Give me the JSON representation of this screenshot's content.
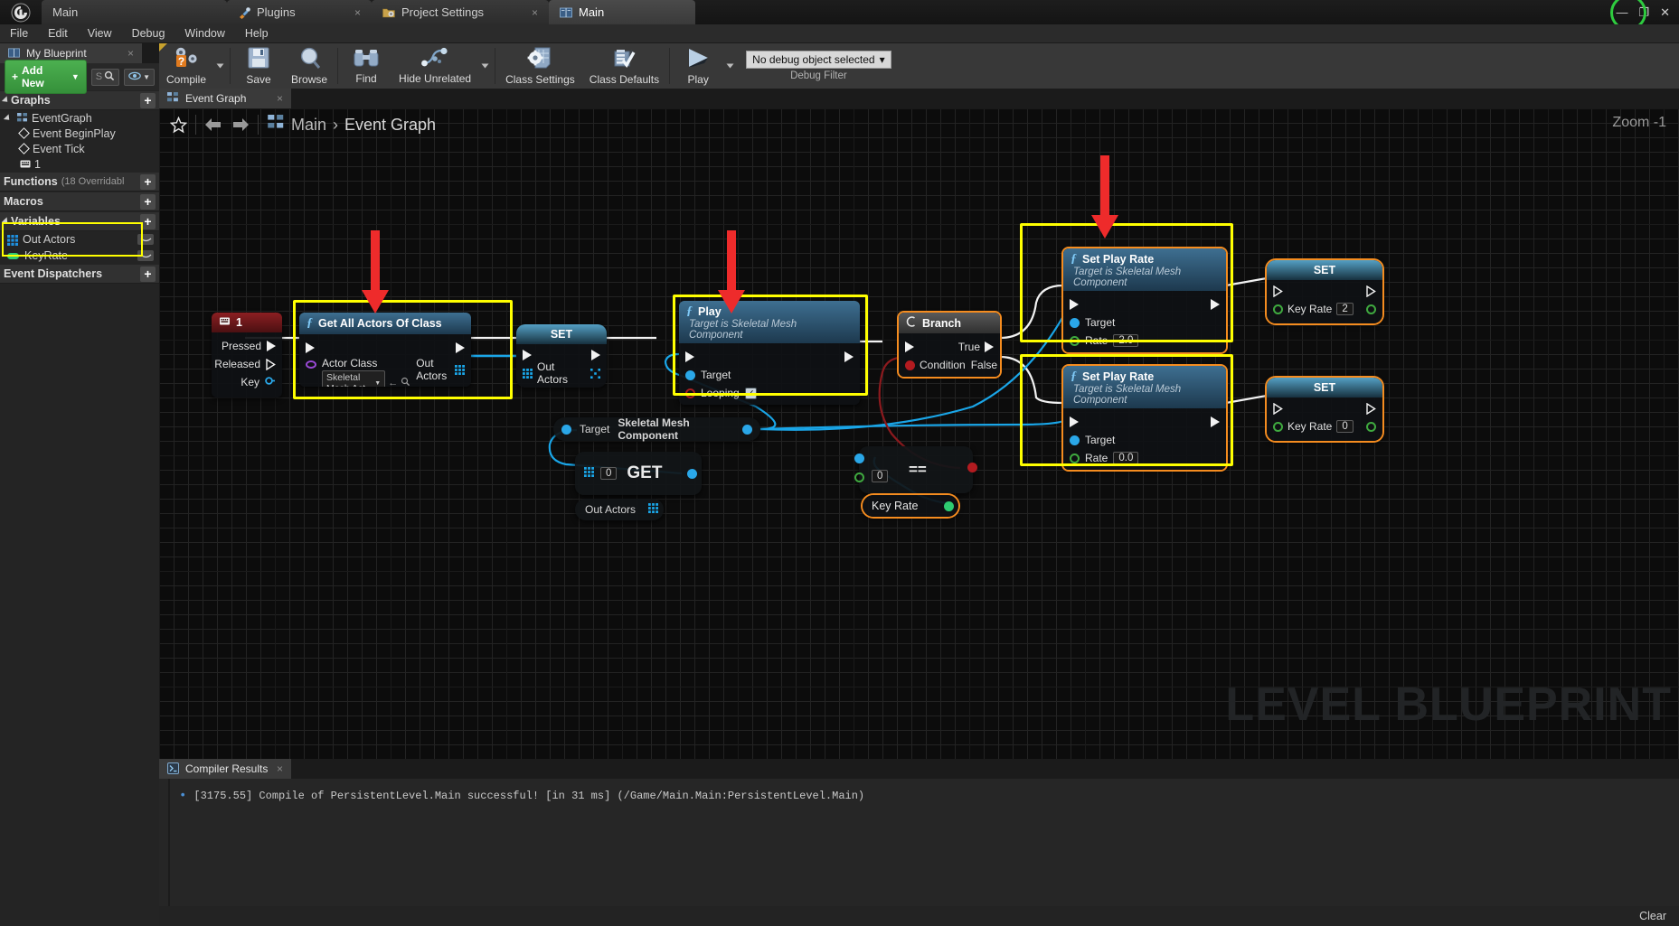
{
  "titlebar": {
    "tabs": [
      {
        "label": "Main",
        "icon": "unreal-logo-icon",
        "closable": false,
        "active": false
      },
      {
        "label": "Plugins",
        "icon": "plugin-icon",
        "closable": true,
        "active": false
      },
      {
        "label": "Project Settings",
        "icon": "folder-gear-icon",
        "closable": true,
        "active": false
      },
      {
        "label": "Main",
        "icon": "blueprint-book-icon",
        "closable": false,
        "active": true
      }
    ],
    "window_controls": [
      "minimize",
      "maximize",
      "close"
    ],
    "minimize_glyph": "—",
    "maximize_glyph": "❐",
    "close_glyph": "✕"
  },
  "menubar": {
    "items": [
      "File",
      "Edit",
      "View",
      "Debug",
      "Window",
      "Help"
    ]
  },
  "left_panel": {
    "tab_title": "My Blueprint",
    "tab_icon": "blueprint-book-icon",
    "add_new_label": "Add New",
    "search_placeholder": "S",
    "sections": {
      "graphs": {
        "title": "Graphs",
        "plus": "+"
      },
      "functions": {
        "title": "Functions",
        "subtitle": "(18 Overridabl",
        "plus": "+"
      },
      "macros": {
        "title": "Macros",
        "plus": "+"
      },
      "variables": {
        "title": "Variables",
        "plus": "+"
      },
      "event_dispatchers": {
        "title": "Event Dispatchers",
        "plus": "+"
      }
    },
    "graph_tree": [
      {
        "label": "EventGraph",
        "icon": "graph-icon",
        "indent": 0
      },
      {
        "label": "Event BeginPlay",
        "icon": "event-diamond-icon",
        "indent": 1
      },
      {
        "label": "Event Tick",
        "icon": "event-diamond-icon",
        "indent": 1
      },
      {
        "label": "1",
        "icon": "keyboard-icon",
        "indent": 1
      }
    ],
    "variables": [
      {
        "label": "Out Actors",
        "type": "array",
        "color": "#1e90e0"
      },
      {
        "label": "KeyRate",
        "type": "float",
        "color": "#2ecc71"
      }
    ],
    "variables_highlighted": true
  },
  "toolbar": {
    "items": [
      {
        "label": "Compile",
        "icon": "compile-gears-icon",
        "has_dropdown": true
      },
      {
        "label": "Save",
        "icon": "save-floppy-icon",
        "has_dropdown": false
      },
      {
        "label": "Browse",
        "icon": "browse-magnifier-icon",
        "has_dropdown": false
      },
      {
        "label": "Find",
        "icon": "find-binoculars-icon",
        "has_dropdown": false
      },
      {
        "label": "Hide Unrelated",
        "icon": "hide-unrelated-graph-icon",
        "has_dropdown": true
      },
      {
        "label": "Class Settings",
        "icon": "class-settings-icon",
        "has_dropdown": false
      },
      {
        "label": "Class Defaults",
        "icon": "class-defaults-icon",
        "has_dropdown": false
      },
      {
        "label": "Play",
        "icon": "play-triangle-icon",
        "has_dropdown": true
      }
    ],
    "debug": {
      "selected": "No debug object selected",
      "caret": "▾",
      "label": "Debug Filter"
    }
  },
  "graph_tab": {
    "label": "Event Graph",
    "icon": "graph-icon",
    "close": "×"
  },
  "canvas": {
    "favorite_icon": "star-icon",
    "back_icon": "arrow-left-icon",
    "forward_icon": "arrow-right-icon",
    "breadcrumb_icon": "graph-icon",
    "breadcrumb": [
      "Main",
      "Event Graph"
    ],
    "breadcrumb_separator": "›",
    "zoom_label": "Zoom -1",
    "watermark": "LEVEL BLUEPRINT"
  },
  "nodes": {
    "key_event": {
      "title": "1",
      "icon": "keyboard-icon",
      "pins": [
        {
          "label": "Pressed",
          "kind": "exec-out"
        },
        {
          "label": "Released",
          "kind": "exec-out"
        },
        {
          "label": "Key",
          "kind": "data-out"
        }
      ]
    },
    "get_all_actors": {
      "title": "Get All Actors Of Class",
      "icon": "function-f-icon",
      "input_pin_label": "Actor Class",
      "actor_class_value": "Skeletal Mesh Act",
      "output_pin_label": "Out Actors",
      "highlighted": true
    },
    "set_out_actors": {
      "title": "SET",
      "pin_label": "Out Actors"
    },
    "play": {
      "title": "Play",
      "subtitle": "Target is Skeletal Mesh Component",
      "icon": "function-f-icon",
      "pins": [
        {
          "label": "Target",
          "kind": "object"
        },
        {
          "label": "Looping",
          "kind": "bool",
          "checked": true
        }
      ],
      "highlighted": true
    },
    "branch": {
      "title": "Branch",
      "icon": "branch-icon",
      "condition_label": "Condition",
      "true_label": "True",
      "false_label": "False",
      "selected": true
    },
    "target_pill": {
      "label_left": "Target",
      "label_right": "Skeletal Mesh Component"
    },
    "get_node": {
      "title": "GET",
      "index_value": "0",
      "output_label": "Out Actors"
    },
    "equals_node": {
      "symbol": "==",
      "value": "0",
      "selected": true
    },
    "key_rate_get": {
      "label": "Key Rate",
      "selected": true
    },
    "set_play_rate_top": {
      "title": "Set Play Rate",
      "subtitle": "Target is Skeletal Mesh Component",
      "icon": "function-f-icon",
      "target_label": "Target",
      "rate_label": "Rate",
      "rate_value": "2.0",
      "highlighted": true,
      "selected": true
    },
    "set_play_rate_bottom": {
      "title": "Set Play Rate",
      "subtitle": "Target is Skeletal Mesh Component",
      "icon": "function-f-icon",
      "target_label": "Target",
      "rate_label": "Rate",
      "rate_value": "0.0",
      "highlighted": true,
      "selected": true
    },
    "set_key_rate_top": {
      "title": "SET",
      "pin_label": "Key Rate",
      "value": "2",
      "selected": true
    },
    "set_key_rate_bottom": {
      "title": "SET",
      "pin_label": "Key Rate",
      "value": "0",
      "selected": true
    }
  },
  "compiler_results": {
    "tab_label": "Compiler Results",
    "tab_icon": "compiler-icon",
    "close": "×",
    "bullet": "•",
    "message": "[3175.55] Compile of PersistentLevel.Main successful! [in 31 ms] (/Game/Main.Main:PersistentLevel.Main)",
    "clear_label": "Clear"
  },
  "colors": {
    "accent_yellow": "#ffff00",
    "accent_orange": "#f58c1f",
    "exec_white": "#f2f2f2",
    "data_blue": "#2aa7e8",
    "bool_red": "#a41d21",
    "float_green": "#3fa93f",
    "class_purple": "#9a49d6",
    "add_new_green": "#4cb050",
    "red_arrow": "#ee2b2b"
  }
}
